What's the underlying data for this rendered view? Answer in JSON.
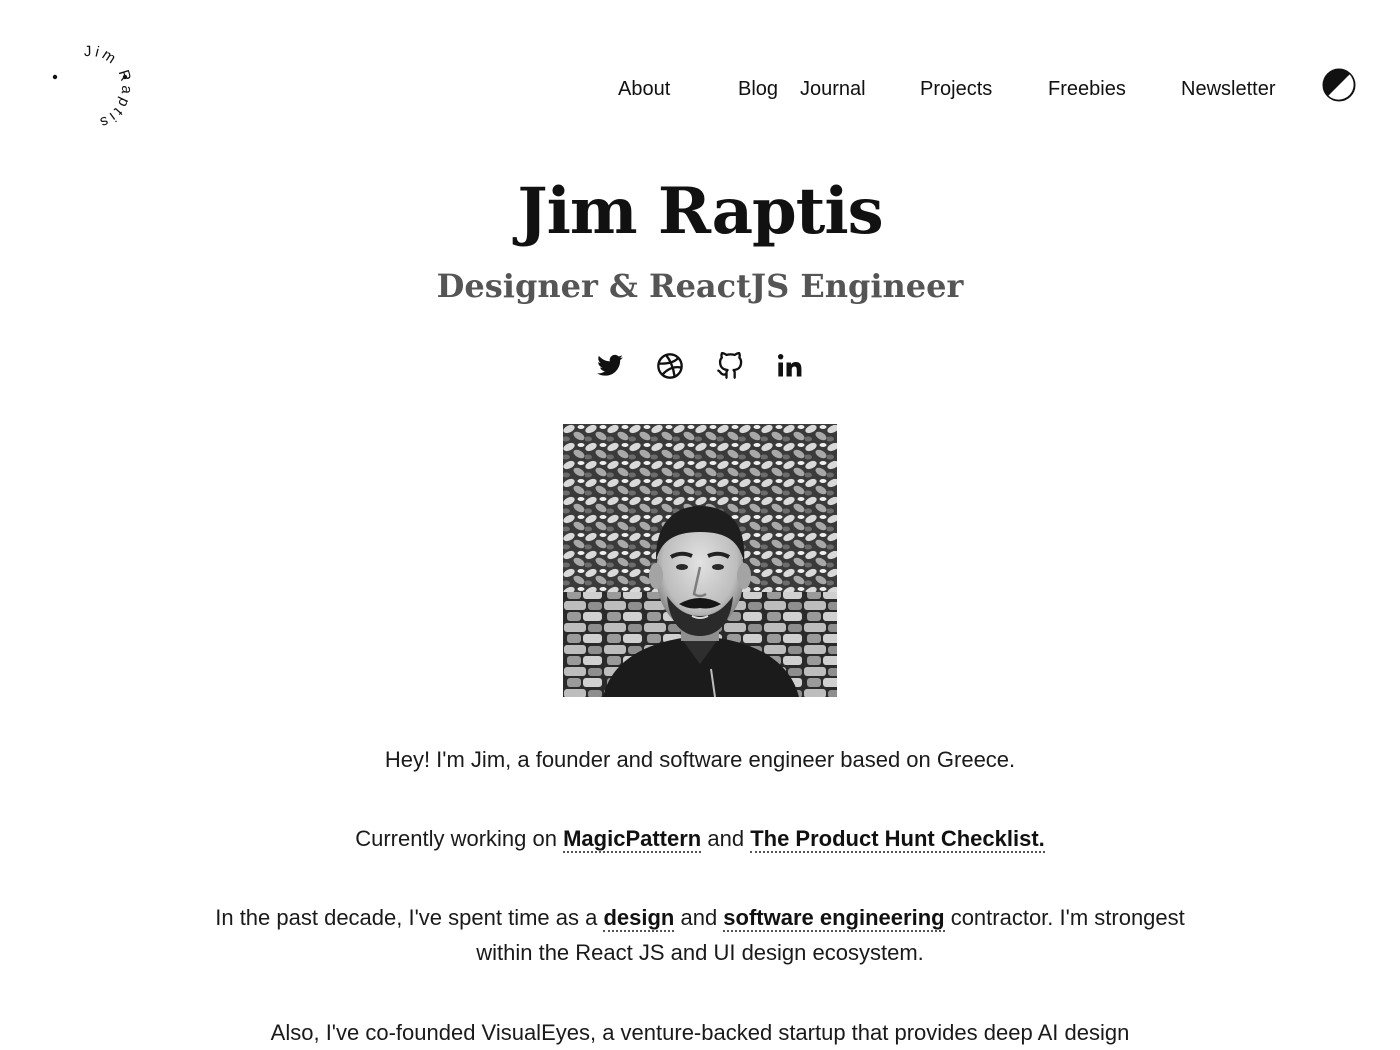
{
  "logo": {
    "text": "Jim Raptis"
  },
  "nav": {
    "items": [
      {
        "label": "About"
      },
      {
        "label": "Blog"
      },
      {
        "label": "Journal"
      },
      {
        "label": "Projects"
      },
      {
        "label": "Freebies"
      },
      {
        "label": "Newsletter"
      }
    ],
    "theme_toggle_icon": "contrast-icon"
  },
  "hero": {
    "title": "Jim Raptis",
    "subtitle": "Designer & ReactJS Engineer"
  },
  "social": [
    {
      "icon": "twitter-icon"
    },
    {
      "icon": "dribbble-icon"
    },
    {
      "icon": "github-icon"
    },
    {
      "icon": "linkedin-icon"
    }
  ],
  "bio": {
    "p1": "Hey! I'm Jim, a founder and software engineer based on Greece.",
    "p2": {
      "prefix": "Currently working on ",
      "link1": "MagicPattern",
      "middle": " and ",
      "link2": "The Product Hunt Checklist."
    },
    "p3": {
      "prefix": "In the past decade, I've spent time as a ",
      "link1": "design",
      "middle": " and ",
      "link2": "software engineering",
      "suffix": " contractor. I'm strongest within the React JS and UI design ecosystem."
    },
    "p4": "Also, I've co-founded VisualEyes, a venture-backed startup that provides deep AI design"
  },
  "colors": {
    "text": "#111111",
    "subtitle": "#555555",
    "background": "#ffffff"
  }
}
